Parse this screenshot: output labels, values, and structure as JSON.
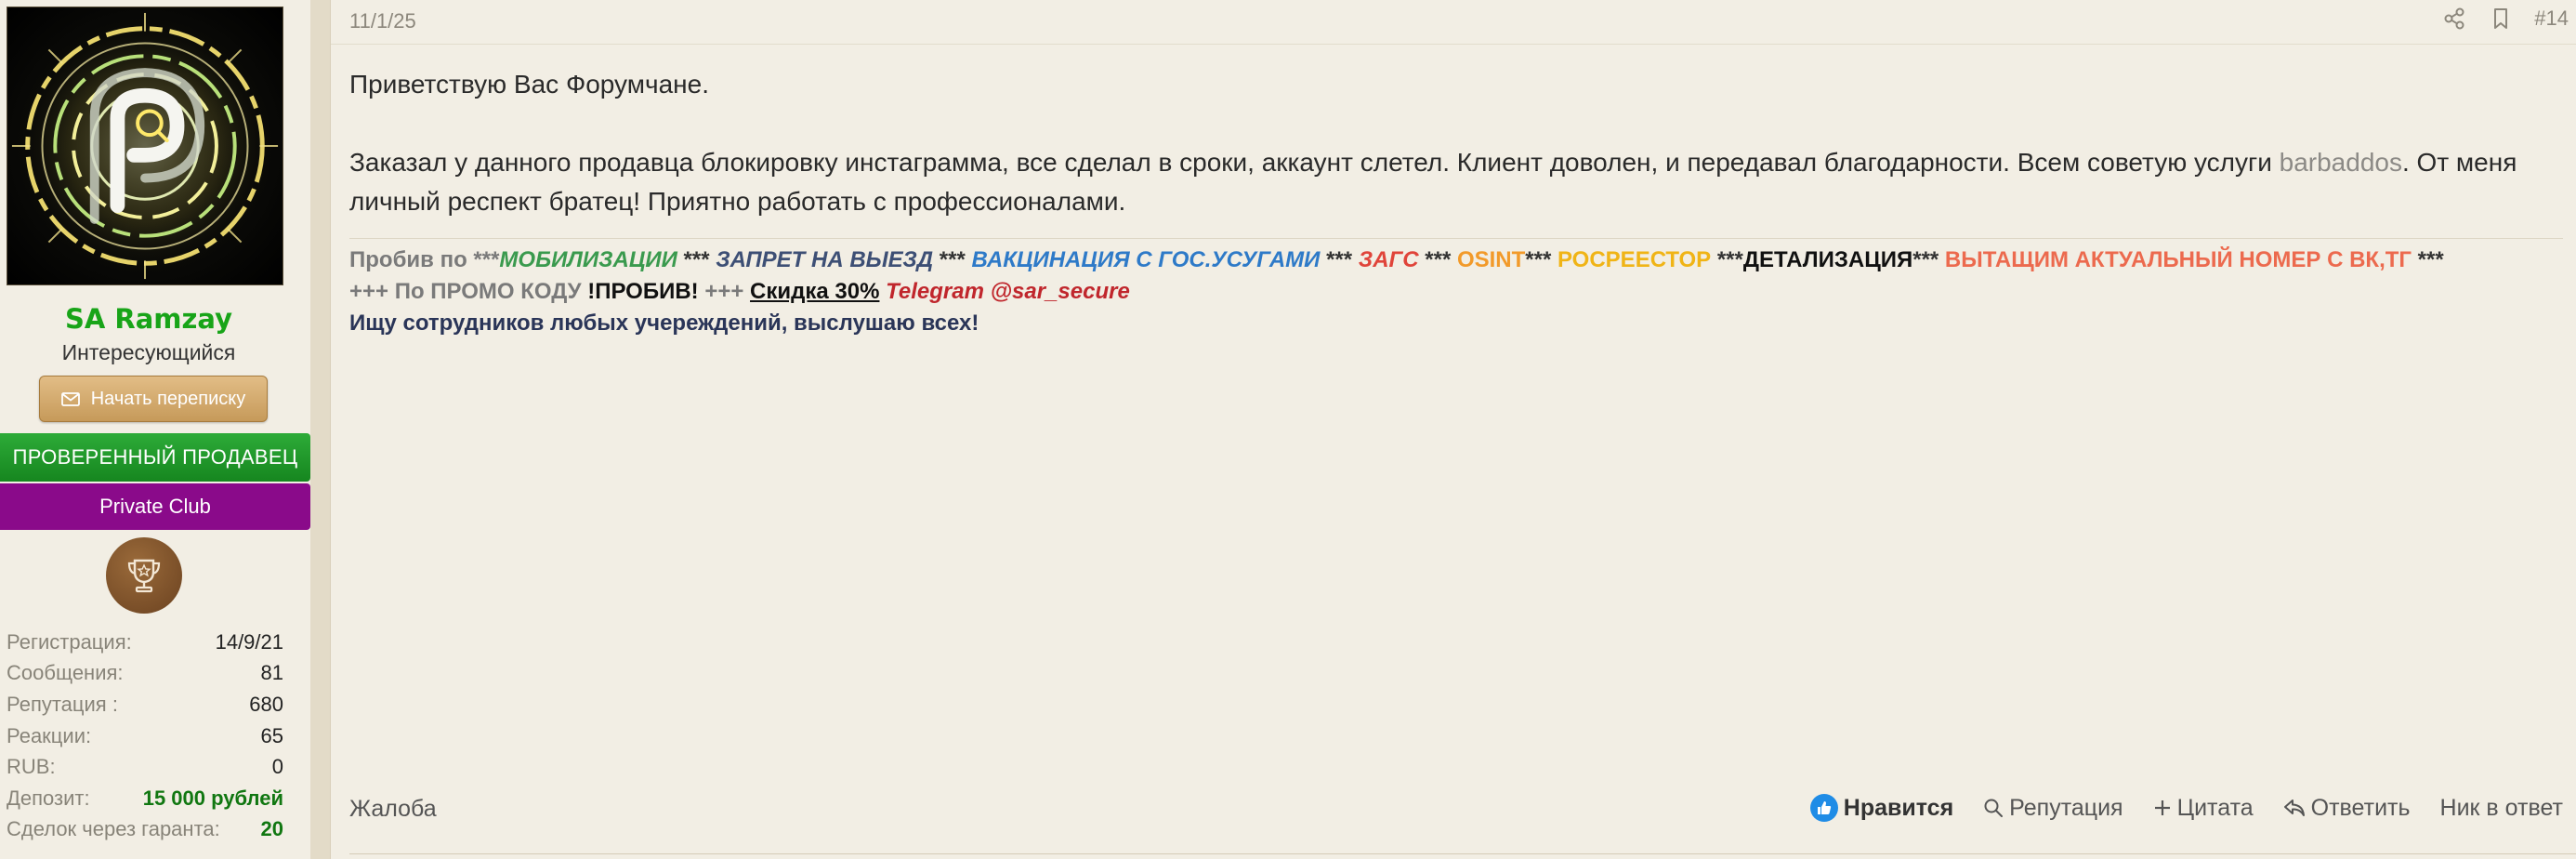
{
  "user": {
    "name": "SA Ramzay",
    "title": "Интересующийся",
    "message_button": "Начать переписку",
    "banner_verified": "ПРОВЕРЕННЫЙ ПРОДАВЕЦ",
    "banner_club": "Private Club",
    "stats": [
      {
        "label": "Регистрация:",
        "value": "14/9/21"
      },
      {
        "label": "Сообщения:",
        "value": "81"
      },
      {
        "label": "Репутация :",
        "value": "680"
      },
      {
        "label": "Реакции:",
        "value": "65"
      },
      {
        "label": "RUB:",
        "value": "0"
      },
      {
        "label": "Депозит:",
        "value": "15 000 рублей"
      },
      {
        "label": "Сделок через гаранта:",
        "value": "20"
      }
    ]
  },
  "post": {
    "date": "11/1/25",
    "number": "#14",
    "greeting": "Приветствую Вас Форумчане.",
    "body_before_link": "Заказал у данного продавца блокировку инстаграмма, все сделал в сроки, аккаунт слетел. Клиент доволен, и передавал благодарности. Всем советую услуги ",
    "body_link": "barbaddos",
    "body_after_link": ". От меня личный респект братец! Приятно работать с профессионалами."
  },
  "signature": {
    "l1_prefix": "Пробив по ***",
    "l1_a": "МОБИЛИЗАЦИИ",
    "l1_s1": " *** ",
    "l1_b": "ЗАПРЕТ НА ВЫЕЗД",
    "l1_s2": " *** ",
    "l1_c": "ВАКЦИНАЦИЯ С ГОС.УСУГАМИ",
    "l1_s3": " *** ",
    "l1_d": "ЗАГС",
    "l1_s4": " *** ",
    "l1_e": "OSINT",
    "l1_s5": "*** ",
    "l1_f": "РОСРЕЕСТОР",
    "l1_s6": " ***",
    "l1_g": "ДЕТАЛИЗАЦИЯ",
    "l1_s7": "*** ",
    "l1_h": "ВЫТАЩИМ АКТУАЛЬНЫЙ НОМЕР С ВК,ТГ",
    "l1_s8": " ***",
    "l2_prefix": "+++ По ПРОМО КОДУ ",
    "l2_code": "!ПРОБИВ!",
    "l2_mid": " +++ ",
    "l2_discount": "Скидка 30%",
    "l2_space": " ",
    "l2_tg": "Telegram @sar_secure",
    "l3": "Ищу сотрудников любых учереждений, выслушаю всех!"
  },
  "footer": {
    "report": "Жалоба",
    "like": "Нравится",
    "reputation": "Репутация",
    "quote": "Цитата",
    "reply": "Ответить",
    "nick": "Ник в ответ"
  },
  "colors": {
    "username": "#18a418",
    "verified_banner": "#16861f",
    "club_banner": "#8a0a8a",
    "like_icon": "#1f8ce6"
  }
}
